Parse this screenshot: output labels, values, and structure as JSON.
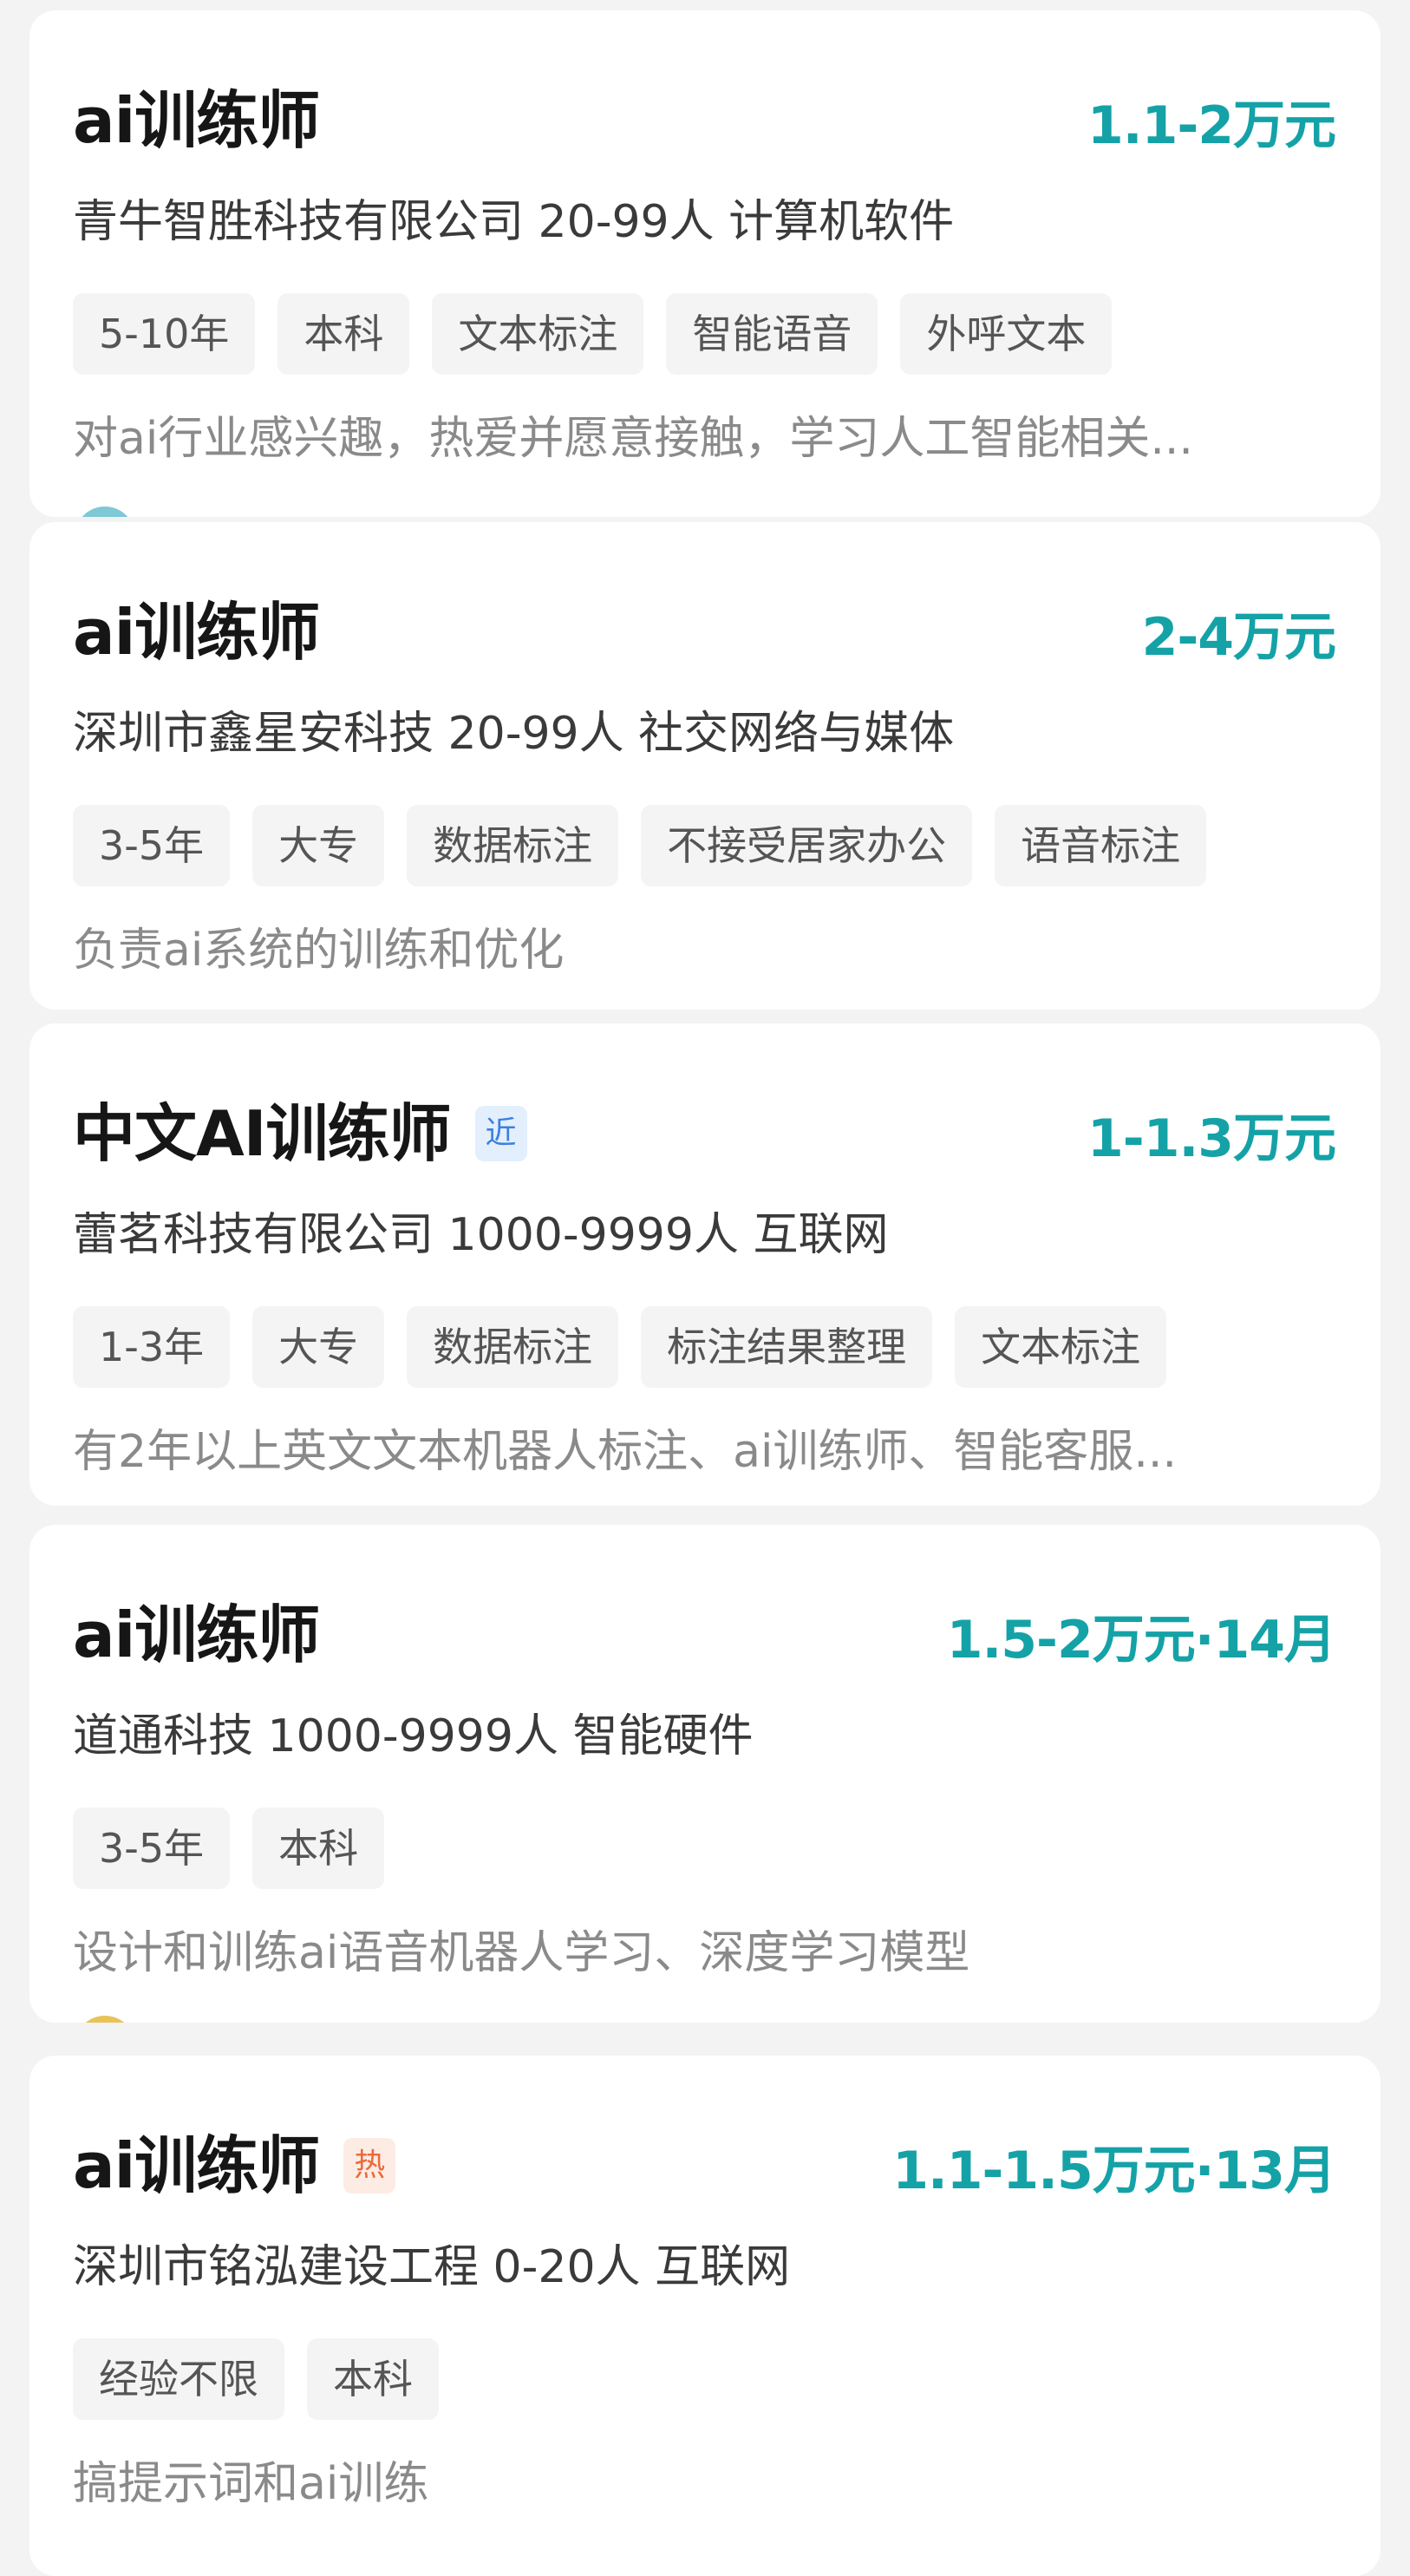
{
  "jobs": [
    {
      "title": "ai训练师",
      "badge": "",
      "salary": "1.1-2万元",
      "company": "青牛智胜科技有限公司 20-99人 计算机软件",
      "tags": [
        "5-10年",
        "本科",
        "文本标注",
        "智能语音",
        "外呼文本"
      ],
      "description": "对ai行业感兴趣，热爱并愿意接触，学习人工智能相关..."
    },
    {
      "title": "ai训练师",
      "badge": "",
      "salary": "2-4万元",
      "company": "深圳市鑫星安科技 20-99人 社交网络与媒体",
      "tags": [
        "3-5年",
        "大专",
        "数据标注",
        "不接受居家办公",
        "语音标注"
      ],
      "description": "负责ai系统的训练和优化"
    },
    {
      "title": "中文AI训练师",
      "badge": "近",
      "salary": "1-1.3万元",
      "company": "蕾茗科技有限公司 1000-9999人 互联网",
      "tags": [
        "1-3年",
        "大专",
        "数据标注",
        "标注结果整理",
        "文本标注"
      ],
      "description": "有2年以上英文文本机器人标注、ai训练师、智能客服..."
    },
    {
      "title": "ai训练师",
      "badge": "",
      "salary": "1.5-2万元·14月",
      "company": "道通科技 1000-9999人 智能硬件",
      "tags": [
        "3-5年",
        "本科"
      ],
      "description": "设计和训练ai语音机器人学习、深度学习模型"
    },
    {
      "title": "ai训练师",
      "badge": "热",
      "salary": "1.1-1.5万元·13月",
      "company": "深圳市铭泓建设工程 0-20人 互联网",
      "tags": [
        "经验不限",
        "本科"
      ],
      "description": "搞提示词和ai训练"
    }
  ],
  "colors": {
    "salary": "#14a2a7",
    "badge_near": "#3c80e0",
    "badge_hot": "#ec6a3c"
  }
}
